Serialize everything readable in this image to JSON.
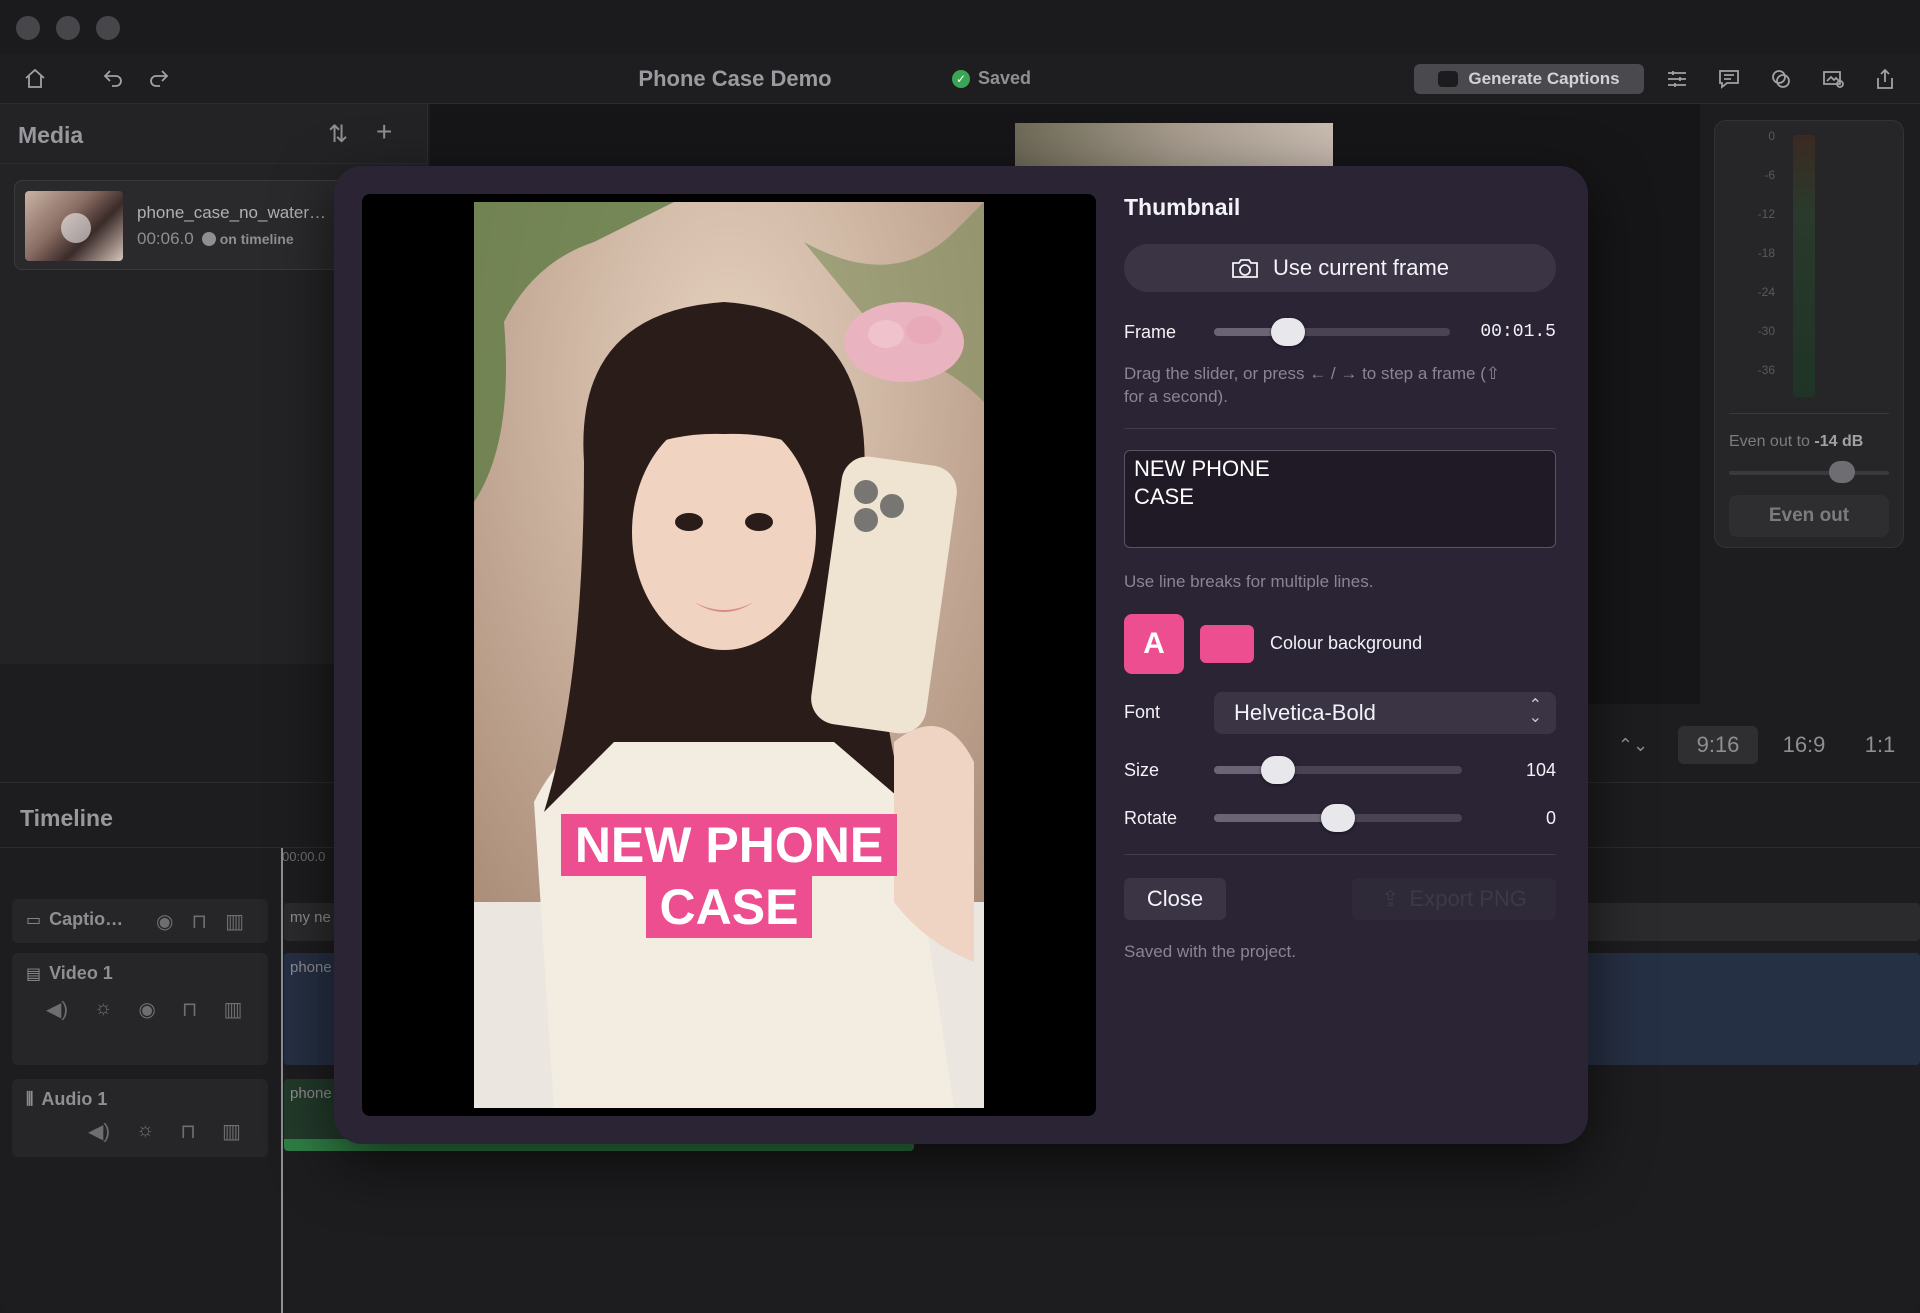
{
  "window": {
    "title": "Phone Case Demo",
    "save_status": "Saved"
  },
  "toolbar": {
    "generate_captions": "Generate Captions",
    "icons": [
      "home-icon",
      "undo-icon",
      "redo-icon",
      "sliders-icon",
      "comment-icon",
      "effects-icon",
      "add-media-icon",
      "share-icon"
    ]
  },
  "media": {
    "title": "Media",
    "item": {
      "name": "phone_case_no_water…",
      "duration": "00:06.0",
      "status": "on timeline"
    }
  },
  "level_panel": {
    "scale": [
      "0",
      "-6",
      "-12",
      "-18",
      "-24",
      "-30",
      "-36"
    ],
    "even_out_prefix": "Even out to",
    "even_out_value": "-14 dB",
    "even_out_button": "Even out"
  },
  "aspect": {
    "options": [
      "9:16",
      "16:9",
      "1:1"
    ],
    "selected": "9:16"
  },
  "timeline": {
    "title": "Timeline",
    "ruler_start": "00:00.0",
    "tracks": [
      {
        "name": "Captio…",
        "clip": "my ne"
      },
      {
        "name": "Video 1",
        "clip": "phone"
      },
      {
        "name": "Audio 1",
        "clip": "phone"
      }
    ]
  },
  "thumbnail": {
    "title": "Thumbnail",
    "use_current_frame": "Use current frame",
    "frame_label": "Frame",
    "frame_time": "00:01.5",
    "frame_position": 0.28,
    "help_line1": "Drag the slider, or press ← / → to step a frame (⇧",
    "help_line2": "for a second).",
    "caption_text": "NEW PHONE\nCASE",
    "caption_lines": [
      "NEW PHONE",
      "CASE"
    ],
    "line_break_help": "Use line breaks for multiple lines.",
    "text_color_label": "A",
    "colour_background_label": "Colour background",
    "caption_color": "#ec4e8f",
    "font_label": "Font",
    "font_value": "Helvetica-Bold",
    "size_label": "Size",
    "size_value": "104",
    "rotate_label": "Rotate",
    "rotate_value": "0",
    "close": "Close",
    "export": "Export PNG",
    "saved_note": "Saved with the project."
  }
}
